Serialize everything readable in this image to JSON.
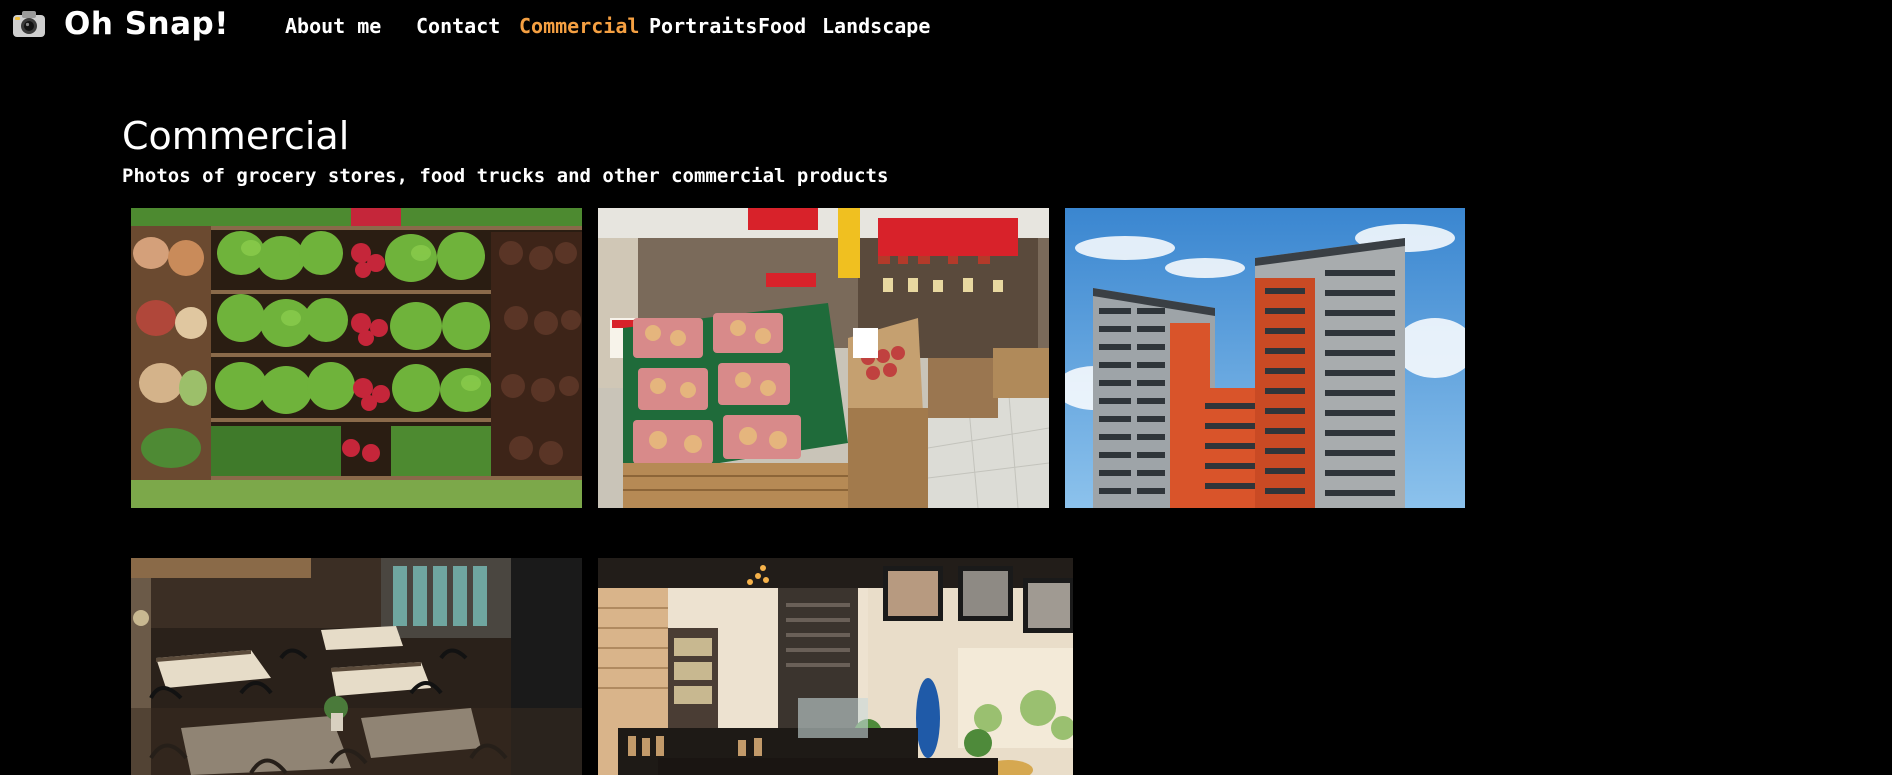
{
  "header": {
    "title": "Oh Snap!",
    "logo_icon": "camera-icon"
  },
  "nav": {
    "items": [
      {
        "label": "About me",
        "active": false
      },
      {
        "label": "Contact",
        "active": false
      },
      {
        "label": "Commercial",
        "active": true
      },
      {
        "label": "Portraits",
        "active": false
      },
      {
        "label": "Food",
        "active": false
      },
      {
        "label": "Landscape",
        "active": false
      }
    ],
    "active_color": "#f5a042"
  },
  "section": {
    "title": "Commercial",
    "subtitle": "Photos of grocery stores, food trucks and other commercial products"
  },
  "gallery": {
    "photos": [
      {
        "subject": "produce-shelves"
      },
      {
        "subject": "supermarket-aisle"
      },
      {
        "subject": "apartment-building"
      },
      {
        "subject": "restaurant-dining-room"
      },
      {
        "subject": "cafe-interior"
      }
    ]
  },
  "colors": {
    "background": "#000000",
    "text": "#ffffff",
    "accent": "#f5a042"
  }
}
